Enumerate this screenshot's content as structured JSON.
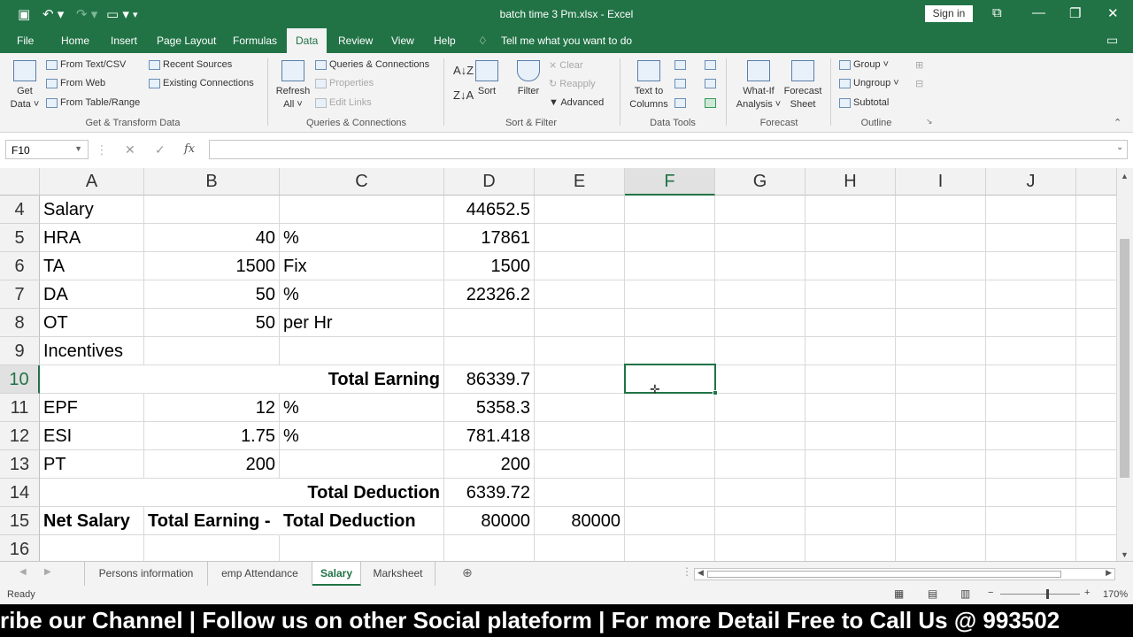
{
  "window": {
    "title": "batch time 3 Pm.xlsx  -  Excel",
    "sign_in": "Sign in"
  },
  "menu": [
    "File",
    "Home",
    "Insert",
    "Page Layout",
    "Formulas",
    "Data",
    "Review",
    "View",
    "Help"
  ],
  "menu_active": "Data",
  "tell_me": "Tell me what you want to do",
  "ribbon": {
    "get_data": [
      "Get",
      "Data ˅"
    ],
    "from_text_csv": "From Text/CSV",
    "from_web": "From Web",
    "from_table_range": "From Table/Range",
    "recent_sources": "Recent Sources",
    "existing_connections": "Existing Connections",
    "group_get_transform": "Get & Transform Data",
    "refresh_all": [
      "Refresh",
      "All ˅"
    ],
    "queries_connections": "Queries & Connections",
    "properties": "Properties",
    "edit_links": "Edit Links",
    "group_queries": "Queries & Connections",
    "sort": "Sort",
    "filter": "Filter",
    "clear": "Clear",
    "reapply": "Reapply",
    "advanced": "Advanced",
    "group_sort_filter": "Sort & Filter",
    "text_to_columns": [
      "Text to",
      "Columns"
    ],
    "group_data_tools": "Data Tools",
    "what_if": [
      "What-If",
      "Analysis ˅"
    ],
    "forecast_sheet": [
      "Forecast",
      "Sheet"
    ],
    "group_forecast": "Forecast",
    "group_btn": "Group ˅",
    "ungroup_btn": "Ungroup ˅",
    "subtotal": "Subtotal",
    "group_outline": "Outline"
  },
  "formula_bar": {
    "name_box": "F10",
    "fx": "fx",
    "cancel": "✕",
    "enter": "✓",
    "formula": ""
  },
  "columns": [
    "A",
    "B",
    "C",
    "D",
    "E",
    "F",
    "G",
    "H",
    "I",
    "J"
  ],
  "selected_column": "F",
  "selected_row": "10",
  "rows": [
    {
      "n": "4",
      "A": "Salary",
      "B": "",
      "C": "",
      "D": "44652.5",
      "E": ""
    },
    {
      "n": "5",
      "A": "HRA",
      "B": "40",
      "C": "%",
      "D": "17861",
      "E": ""
    },
    {
      "n": "6",
      "A": "TA",
      "B": "1500",
      "C": "Fix",
      "D": "1500",
      "E": ""
    },
    {
      "n": "7",
      "A": "DA",
      "B": "50",
      "C": "%",
      "D": "22326.2",
      "E": ""
    },
    {
      "n": "8",
      "A": "OT",
      "B": "50",
      "C": "per Hr",
      "D": "",
      "E": ""
    },
    {
      "n": "9",
      "A": "Incentives",
      "B": "",
      "C": "",
      "D": "",
      "E": ""
    },
    {
      "n": "10",
      "merged": "Total Earning",
      "D": "86339.7",
      "E": ""
    },
    {
      "n": "11",
      "A": "EPF",
      "B": "12",
      "C": "%",
      "D": "5358.3",
      "E": ""
    },
    {
      "n": "12",
      "A": "ESI",
      "B": "1.75",
      "C": "%",
      "D": "781.418",
      "E": ""
    },
    {
      "n": "13",
      "A": "PT",
      "B": "200",
      "C": "",
      "D": "200",
      "E": ""
    },
    {
      "n": "14",
      "merged": "Total Deduction",
      "D": "6339.72",
      "E": ""
    },
    {
      "n": "15",
      "A": "Net Salary",
      "B": "Total Earning -",
      "C": "Total Deduction",
      "D": "80000",
      "E": "80000",
      "bold": true
    },
    {
      "n": "16",
      "A": "",
      "B": "",
      "C": "",
      "D": "",
      "E": ""
    }
  ],
  "sheets": [
    "Persons information",
    "emp Attendance",
    "Salary",
    "Marksheet"
  ],
  "active_sheet": "Salary",
  "status": {
    "ready": "Ready",
    "zoom": "170%"
  },
  "ticker": "ribe our Channel | Follow us on other Social plateform | For more Detail Free to Call Us @ 993502"
}
